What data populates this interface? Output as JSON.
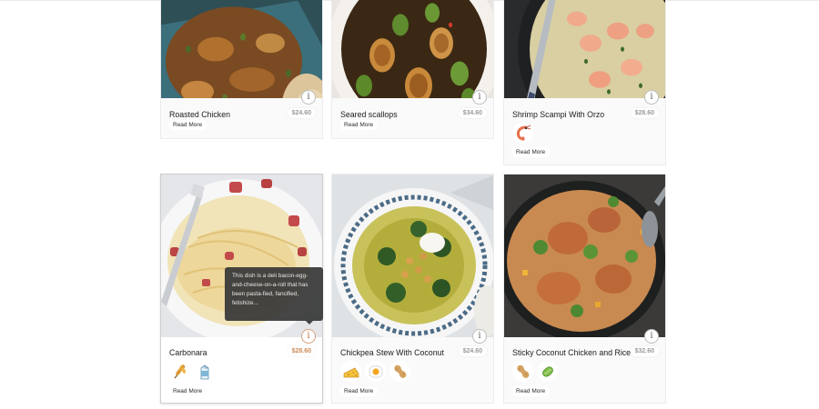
{
  "cards": [
    {
      "title": "Roasted Chicken",
      "price": "$24.60",
      "read_more": "Read More",
      "photo": "roasted-chicken-photo",
      "ingredients": []
    },
    {
      "title": "Seared scallops",
      "price": "$34.60",
      "read_more": "Read More",
      "photo": "seared-scallops-photo",
      "ingredients": []
    },
    {
      "title": "Shrimp Scampi With Orzo",
      "price": "$28.60",
      "read_more": "Read More",
      "photo": "shrimp-scampi-photo",
      "ingredients": [
        "shrimp-icon"
      ]
    },
    {
      "title": "Carbonara",
      "price": "$28.60",
      "read_more": "Read More",
      "photo": "carbonara-photo",
      "ingredients": [
        "wheat-icon",
        "milk-carton-icon"
      ],
      "tooltip": "This dish is a deli bacon-egg-and-cheese-on-a-roll that has been pasta-fied, fancified, fetishize..."
    },
    {
      "title": "Chickpea Stew With Coconut",
      "price": "$24.60",
      "read_more": "Read More",
      "photo": "chickpea-stew-photo",
      "ingredients": [
        "cheese-icon",
        "egg-icon",
        "peanut-icon"
      ]
    },
    {
      "title": "Sticky Coconut Chicken and Rice",
      "price": "$32.60",
      "read_more": "Read More",
      "photo": "coconut-chicken-rice-photo",
      "ingredients": [
        "peanut-icon",
        "soybean-icon"
      ]
    }
  ],
  "colors": {
    "accent_price": "#cd8a56",
    "tooltip_bg": "#383838"
  }
}
